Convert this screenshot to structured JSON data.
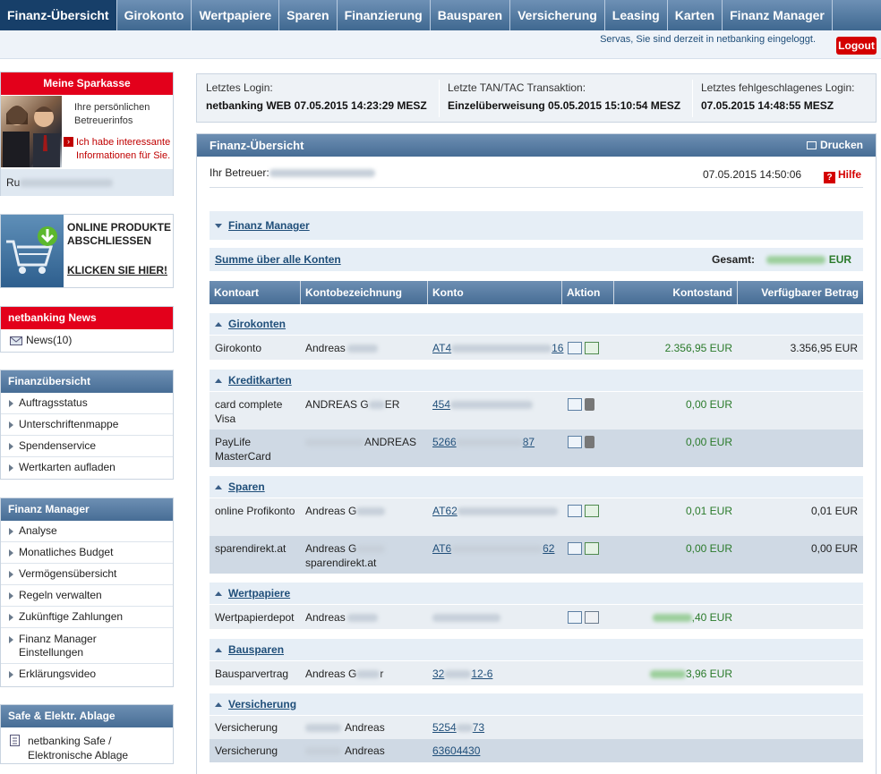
{
  "nav": {
    "items": [
      "Finanz-Übersicht",
      "Girokonto",
      "Wertpapiere",
      "Sparen",
      "Finanzierung",
      "Bausparen",
      "Versicherung",
      "Leasing",
      "Karten",
      "Finanz Manager"
    ]
  },
  "topbar": {
    "status": "Servas, Sie sind derzeit in netbanking eingeloggt.",
    "logout": "Logout"
  },
  "sidebar": {
    "sparkasse": {
      "title": "Meine Sparkasse",
      "info": "Ihre persönlichen Betreuerinfos",
      "link": "Ich habe interessante Informationen für Sie.",
      "name_prefix": "Ru"
    },
    "promo": {
      "line1": "ONLINE PRODUKTE",
      "line2": "ABSCHLIESSEN",
      "cta": "KLICKEN SIE HIER!"
    },
    "news": {
      "title": "netbanking News",
      "item": "News(10)"
    },
    "finanzuebersicht": {
      "title": "Finanzübersicht",
      "items": [
        "Auftragsstatus",
        "Unterschriftenmappe",
        "Spendenservice",
        "Wertkarten aufladen"
      ]
    },
    "finanzmanager": {
      "title": "Finanz Manager",
      "items": [
        "Analyse",
        "Monatliches Budget",
        "Vermögensübersicht",
        "Regeln verwalten",
        "Zukünftige Zahlungen",
        "Finanz Manager Einstellungen",
        "Erklärungsvideo"
      ]
    },
    "safe": {
      "title": "Safe & Elektr. Ablage",
      "item": "netbanking Safe / Elektronische Ablage"
    }
  },
  "login": {
    "last_login_label": "Letztes Login:",
    "last_login_value": "netbanking WEB 07.05.2015 14:23:29 MESZ",
    "last_tan_label": "Letzte TAN/TAC Transaktion:",
    "last_tan_value": "Einzelüberweisung 05.05.2015 15:10:54 MESZ",
    "last_fail_label": "Letztes fehlgeschlagenes Login:",
    "last_fail_value": "07.05.2015 14:48:55 MESZ"
  },
  "main": {
    "title": "Finanz-Übersicht",
    "print": "Drucken",
    "betreuer_label": "Ihr Betreuer:",
    "datetime": "07.05.2015 14:50:06",
    "help": "Hilfe",
    "finanz_manager": "Finanz Manager",
    "sum_label": "Summe über alle Konten",
    "total_label": "Gesamt:",
    "total_currency": "EUR",
    "columns": [
      "Kontoart",
      "Kontobezeichnung",
      "Konto",
      "Aktion",
      "Kontostand",
      "Verfügbarer Betrag"
    ],
    "sections": {
      "giro": "Girokonten",
      "kredit": "Kreditkarten",
      "sparen": "Sparen",
      "wertpapiere": "Wertpapiere",
      "bausparen": "Bausparen",
      "versicherung": "Versicherung"
    },
    "rows": {
      "giro1": {
        "art": "Girokonto",
        "bez": "Andreas",
        "konto": "AT4",
        "konto_end": "16",
        "stand": "2.356,95 EUR",
        "verf": "3.356,95 EUR"
      },
      "kk1": {
        "art": "card complete Visa",
        "bez": "ANDREAS G",
        "bez_end": "ER",
        "konto": "454",
        "stand": "0,00 EUR"
      },
      "kk2": {
        "art": "PayLife MasterCard",
        "bez_end": "ANDREAS",
        "konto": "5266",
        "konto_end": "87",
        "stand": "0,00 EUR"
      },
      "sp1": {
        "art": "online Profikonto",
        "bez": "Andreas G",
        "konto": "AT62",
        "stand": "0,01 EUR",
        "verf": "0,01 EUR"
      },
      "sp2": {
        "art": "sparendirekt.at",
        "bez": "Andreas G",
        "bez2": "sparendirekt.at",
        "konto": "AT6",
        "konto_end": "62",
        "stand": "0,00 EUR",
        "verf": "0,00 EUR"
      },
      "wp1": {
        "art": "Wertpapierdepot",
        "bez": "Andreas",
        "stand_end": ",40 EUR"
      },
      "bs1": {
        "art": "Bausparvertrag",
        "bez": "Andreas G",
        "bez_end": "r",
        "konto": "32",
        "konto_end": "12-6",
        "stand_end": "3,96 EUR"
      },
      "vs1": {
        "art": "Versicherung",
        "bez_end": "Andreas",
        "konto": "5254",
        "konto_end": "73"
      },
      "vs2": {
        "art": "Versicherung",
        "bez_end": "Andreas",
        "konto": "63604430"
      }
    }
  }
}
